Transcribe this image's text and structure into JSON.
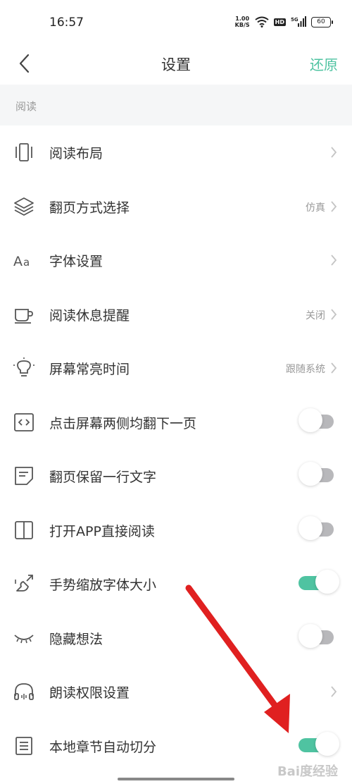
{
  "status_bar": {
    "time": "16:57",
    "net_speed_value": "1.00",
    "net_speed_unit": "KB/S",
    "hd_label": "HD",
    "signal_label": "5G",
    "battery": "60"
  },
  "nav": {
    "back_icon": "chevron-left-icon",
    "title": "设置",
    "restore_label": "还原"
  },
  "section": {
    "label": "阅读"
  },
  "accent_color": "#4fc3a1",
  "settings": [
    {
      "label": "阅读布局",
      "value": "",
      "icon": "layout-icon",
      "control": "chevron"
    },
    {
      "label": "翻页方式选择",
      "value": "仿真",
      "icon": "layers-icon",
      "control": "chevron"
    },
    {
      "label": "字体设置",
      "value": "",
      "icon": "font-icon",
      "control": "chevron"
    },
    {
      "label": "阅读休息提醒",
      "value": "关闭",
      "icon": "coffee-cup-icon",
      "control": "chevron"
    },
    {
      "label": "屏幕常亮时间",
      "value": "跟随系统",
      "icon": "light-bulb-icon",
      "control": "chevron"
    },
    {
      "label": "点击屏幕两侧均翻下一页",
      "value": "",
      "icon": "code-brackets-icon",
      "control": "toggle",
      "on": false
    },
    {
      "label": "翻页保留一行文字",
      "value": "",
      "icon": "note-icon",
      "control": "toggle",
      "on": false
    },
    {
      "label": "打开APP直接阅读",
      "value": "",
      "icon": "open-book-icon",
      "control": "toggle",
      "on": false
    },
    {
      "label": "手势缩放字体大小",
      "value": "",
      "icon": "pinch-gesture-icon",
      "control": "toggle",
      "on": true
    },
    {
      "label": "隐藏想法",
      "value": "",
      "icon": "closed-eye-icon",
      "control": "toggle",
      "on": false
    },
    {
      "label": "朗读权限设置",
      "value": "",
      "icon": "headphones-icon",
      "control": "chevron"
    },
    {
      "label": "本地章节自动切分",
      "value": "",
      "icon": "list-icon",
      "control": "toggle",
      "on": true
    }
  ],
  "annotation": {
    "arrow_color": "#e02020",
    "arrow_icon": "red-arrow-icon"
  },
  "watermark": "Bai度经验"
}
